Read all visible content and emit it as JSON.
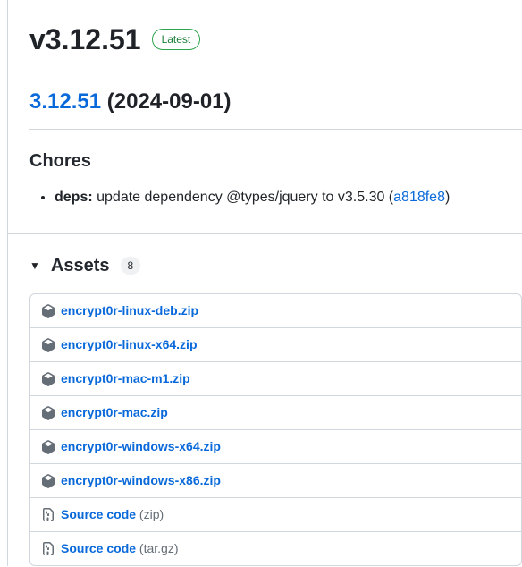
{
  "release": {
    "title": "v3.12.51",
    "latest_label": "Latest",
    "version_link": "3.12.51",
    "date": "(2024-09-01)"
  },
  "chores": {
    "heading": "Chores",
    "items": [
      {
        "prefix": "deps:",
        "text": " update dependency @types/jquery to v3.5.30 (",
        "commit": "a818fe8",
        "suffix": ")"
      }
    ]
  },
  "assets": {
    "toggle": "▼",
    "title": "Assets",
    "count": "8",
    "files": [
      {
        "name": "encrypt0r-linux-deb.zip",
        "icon": "package"
      },
      {
        "name": "encrypt0r-linux-x64.zip",
        "icon": "package"
      },
      {
        "name": "encrypt0r-mac-m1.zip",
        "icon": "package"
      },
      {
        "name": "encrypt0r-mac.zip",
        "icon": "package"
      },
      {
        "name": "encrypt0r-windows-x64.zip",
        "icon": "package"
      },
      {
        "name": "encrypt0r-windows-x86.zip",
        "icon": "package"
      },
      {
        "name": "Source code",
        "suffix": " (zip)",
        "icon": "zip"
      },
      {
        "name": "Source code",
        "suffix": " (tar.gz)",
        "icon": "zip"
      }
    ]
  }
}
